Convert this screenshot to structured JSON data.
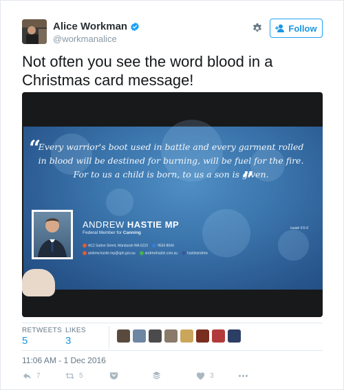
{
  "author": {
    "name": "Alice Workman",
    "handle": "@workmanalice",
    "verified": true
  },
  "follow_label": "Follow",
  "tweet_text": "Not often you see the word blood in a Christmas card message!",
  "card": {
    "quote_lines": [
      "Every warrior's boot used in battle and every garment rolled",
      "in blood will be destined for burning, will be fuel for the fire.",
      "For to us a child is born, to us a son is given."
    ],
    "citation": "Isaiah 9:5-6",
    "mp_first": "ANDREW",
    "mp_last": "HASTIE MP",
    "role_prefix": "Federal Member for",
    "role_seat": "Canning",
    "address": "4/12 Sutton Street, Mandurah WA 6210",
    "phone": "9534 8044",
    "email": "andrew.hastie.mp@aph.gov.au",
    "website": "andrewhastie.com.au",
    "facebook": "hastieandrew"
  },
  "stats": {
    "retweets_label": "RETWEETS",
    "retweets": "5",
    "likes_label": "LIKES",
    "likes": "3"
  },
  "liker_colors": [
    "#5a4a3e",
    "#6f86a3",
    "#4b4b4b",
    "#8a7a6a",
    "#c9a65a",
    "#7a2e1e",
    "#b33a3a",
    "#2c3e66"
  ],
  "timestamp": "11:06 AM - 1 Dec 2016",
  "actions": {
    "reply_count": "7",
    "retweet_count": "5",
    "like_count": "3"
  },
  "colors": {
    "accent": "#1b95e0",
    "muted": "#657786",
    "icon": "#aab8c2"
  }
}
